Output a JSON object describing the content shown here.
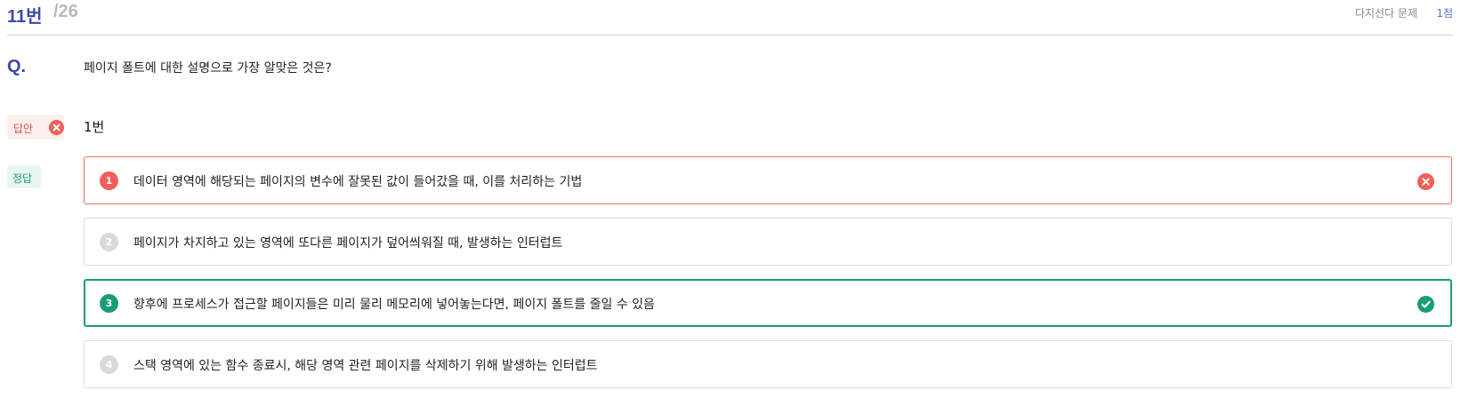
{
  "header": {
    "number": "11번",
    "total": "/26",
    "type": "다지선다 문제",
    "points": "1점"
  },
  "question": {
    "label": "Q.",
    "text": "페이지 폴트에 대한 설명으로 가장 알맞은 것은?"
  },
  "my_answer": {
    "label": "답안",
    "value": "1번",
    "status_icon": "x-circle-icon"
  },
  "correct": {
    "label": "정답"
  },
  "choices": [
    {
      "num": "1",
      "text": "데이터 영역에 해당되는 페이지의 변수에 잘못된 값이 들어갔을 때, 이를 처리하는 기법",
      "state": "selected-wrong"
    },
    {
      "num": "2",
      "text": "페이지가 차지하고 있는 영역에 또다른 페이지가 덮어씌워질 때, 발생하는 인터럽트",
      "state": "none"
    },
    {
      "num": "3",
      "text": "향후에 프로세스가 접근할 페이지들은 미리 물리 메모리에 넣어놓는다면, 페이지 폴트를 줄일 수 있음",
      "state": "correct"
    },
    {
      "num": "4",
      "text": "스택 영역에 있는 함수 종료시, 해당 영역 관련 페이지를 삭제하기 위해 발생하는 인터럽트",
      "state": "none"
    }
  ],
  "colors": {
    "accent": "#3d4aa8",
    "wrong": "#f25e58",
    "correct": "#1a9b7a",
    "neutral": "#d9d9d9"
  }
}
